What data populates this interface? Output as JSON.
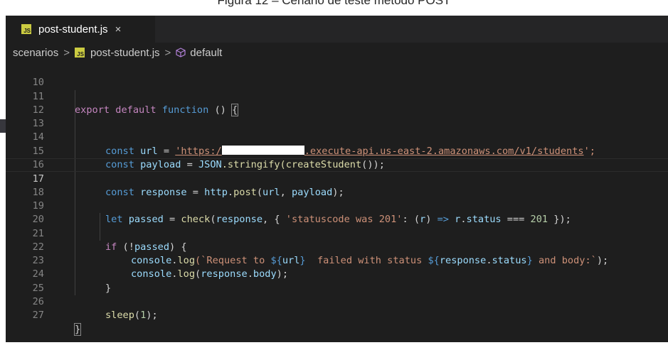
{
  "caption": "Figura 12 – Cenário de teste método POST",
  "tab": {
    "icon_label": "JS",
    "title": "post-student.js",
    "close": "×"
  },
  "breadcrumb": {
    "folder": "scenarios",
    "file": "post-student.js",
    "symbol": "default",
    "separator": ">"
  },
  "code": {
    "line_numbers": [
      "10",
      "11",
      "12",
      "13",
      "14",
      "15",
      "16",
      "17",
      "18",
      "19",
      "20",
      "21",
      "22",
      "23",
      "24",
      "25",
      "26",
      "27"
    ],
    "active_line": "17",
    "lines": {
      "l11": [
        "export",
        "default",
        "function",
        "()",
        "{"
      ],
      "l13": [
        "const",
        "url",
        "=",
        "'https:/",
        ".execute-api.us-east-2.amazonaws.com/v1/students",
        "';"
      ],
      "l14": [
        "const",
        "payload",
        "=",
        "JSON",
        ".stringify(",
        "createStudent",
        "());"
      ],
      "l16": [
        "const",
        "response",
        "=",
        "http",
        ".",
        "post",
        "(",
        "url",
        ", ",
        "payload",
        ");"
      ],
      "l18": [
        "let",
        "passed",
        "=",
        "check",
        "(",
        "response",
        ", { ",
        "'statuscode was 201'",
        ": (",
        "r",
        ") ",
        "=>",
        " ",
        "r",
        ".",
        "status",
        " === ",
        "201",
        " });"
      ],
      "l20": [
        "if",
        " (!",
        "passed",
        ") {"
      ],
      "l21": [
        "console",
        ".",
        "log",
        "(`Request to ",
        "${",
        "url",
        "}",
        "  failed with status ",
        "${",
        "response",
        ".",
        "status",
        "}",
        " and body:`",
        ");"
      ],
      "l22": [
        "console",
        ".",
        "log",
        "(",
        "response",
        ".",
        "body",
        ");"
      ],
      "l23": [
        "}"
      ],
      "l25": [
        "sleep",
        "(",
        "1",
        ");"
      ],
      "l27": [
        "}"
      ]
    }
  }
}
